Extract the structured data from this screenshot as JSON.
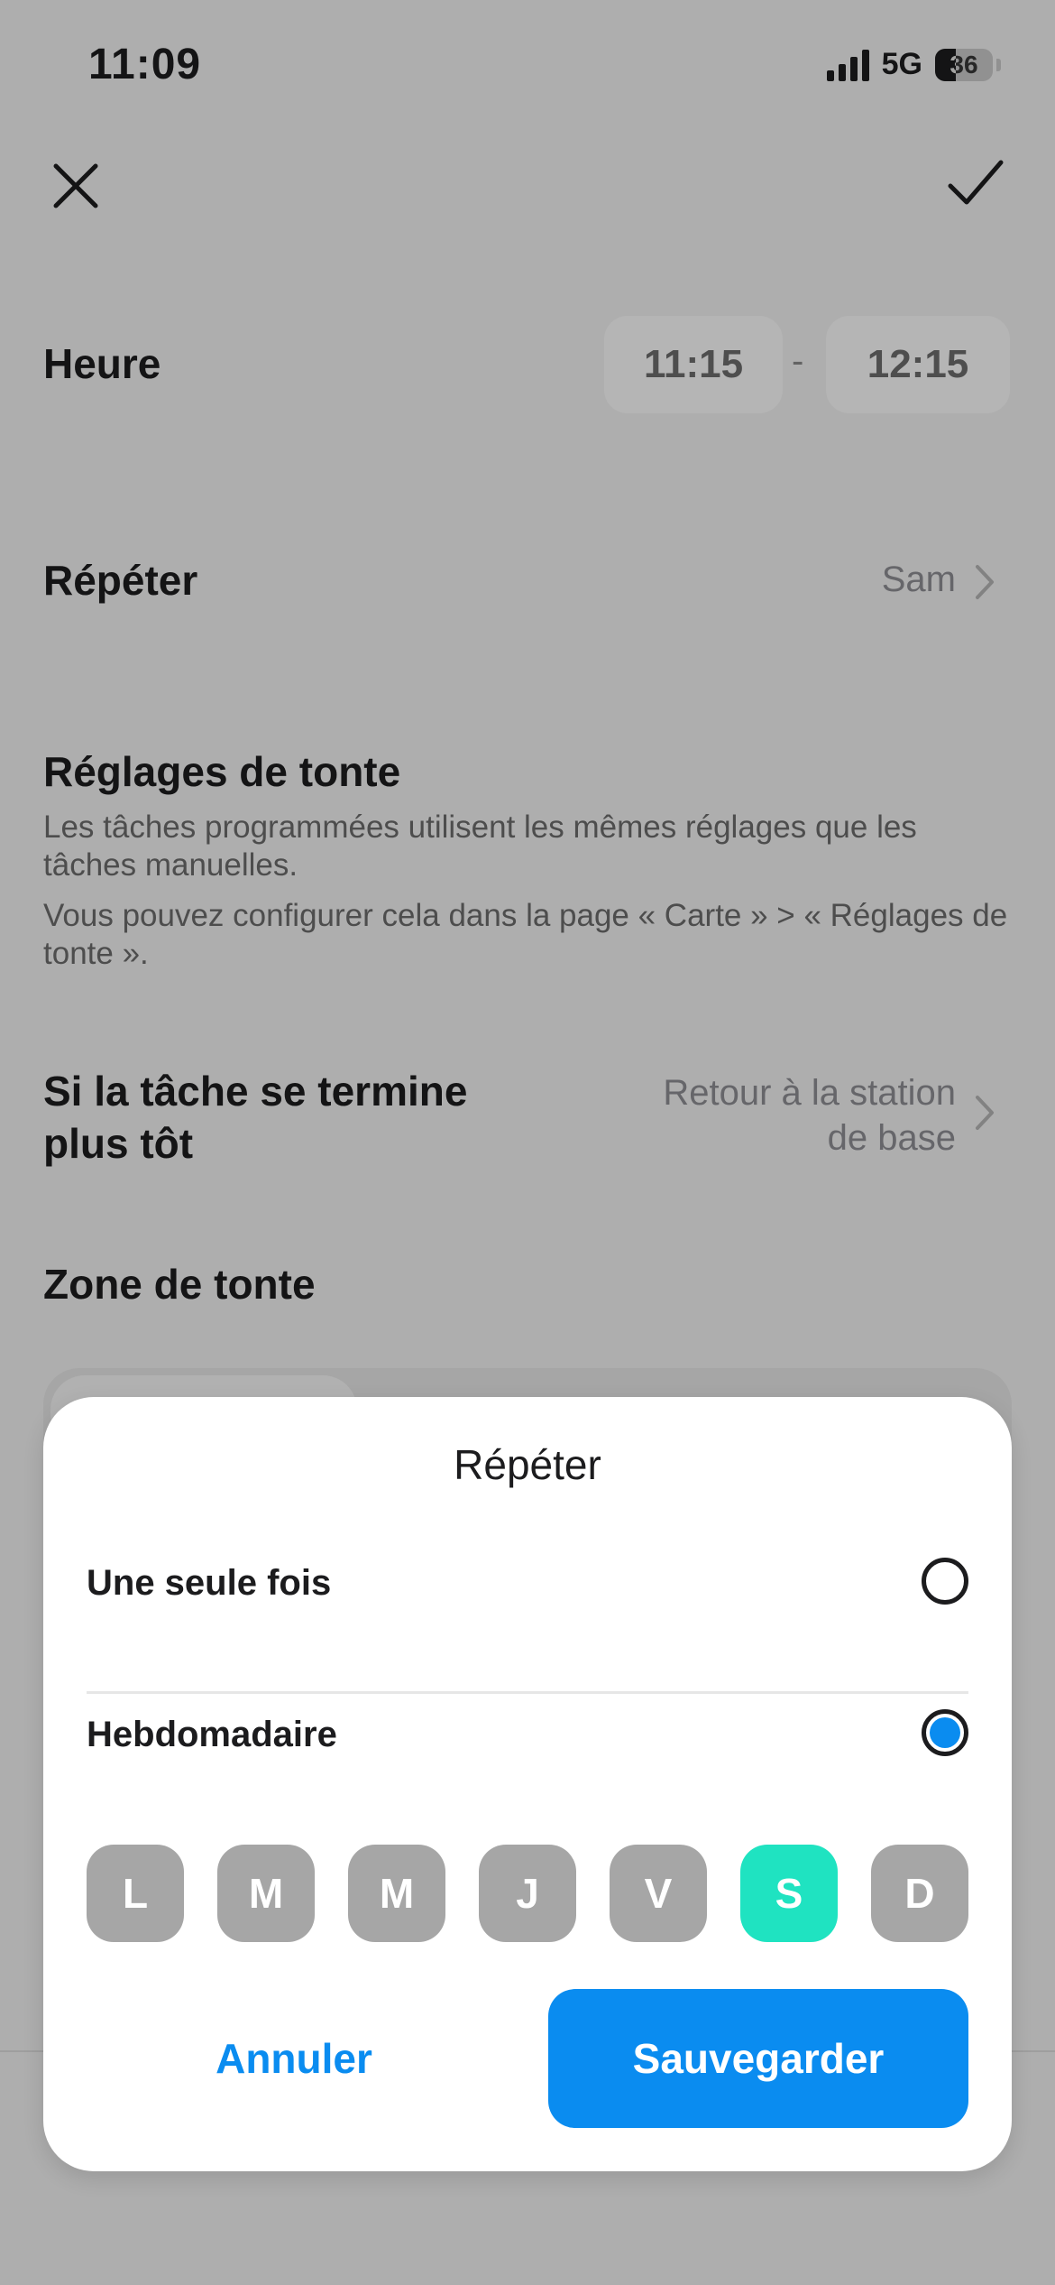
{
  "status_bar": {
    "time": "11:09",
    "network": "5G",
    "battery": "36",
    "battery_level": 0.36
  },
  "header": {
    "close_icon": "close-icon",
    "confirm_icon": "checkmark-icon"
  },
  "time_row": {
    "label": "Heure",
    "start": "11:15",
    "separator": "-",
    "end": "12:15"
  },
  "repeat_row": {
    "label": "Répéter",
    "value": "Sam"
  },
  "mowing_settings": {
    "title": "Réglages de tonte",
    "desc1": "Les tâches programmées utilisent les mêmes réglages que les tâches manuelles.",
    "desc2": "Vous pouvez configurer cela dans la page « Carte » > « Réglages de tonte »."
  },
  "early_finish": {
    "label_line1": "Si la tâche se termine",
    "label_line2": "plus tôt",
    "value_line1": "Retour à la station",
    "value_line2": "de base"
  },
  "zone": {
    "label": "Zone de tonte"
  },
  "sheet": {
    "title": "Répéter",
    "option_once": "Une seule fois",
    "option_weekly": "Hebdomadaire",
    "selected_option": "Hebdomadaire",
    "days": [
      {
        "label": "L",
        "selected": false
      },
      {
        "label": "M",
        "selected": false
      },
      {
        "label": "M",
        "selected": false
      },
      {
        "label": "J",
        "selected": false
      },
      {
        "label": "V",
        "selected": false
      },
      {
        "label": "S",
        "selected": true
      },
      {
        "label": "D",
        "selected": false
      }
    ],
    "cancel": "Annuler",
    "save": "Sauvegarder"
  },
  "colors": {
    "accent": "#0a8cf0",
    "day_active": "#1fe3c1",
    "day_inactive": "#a6a6a6"
  }
}
